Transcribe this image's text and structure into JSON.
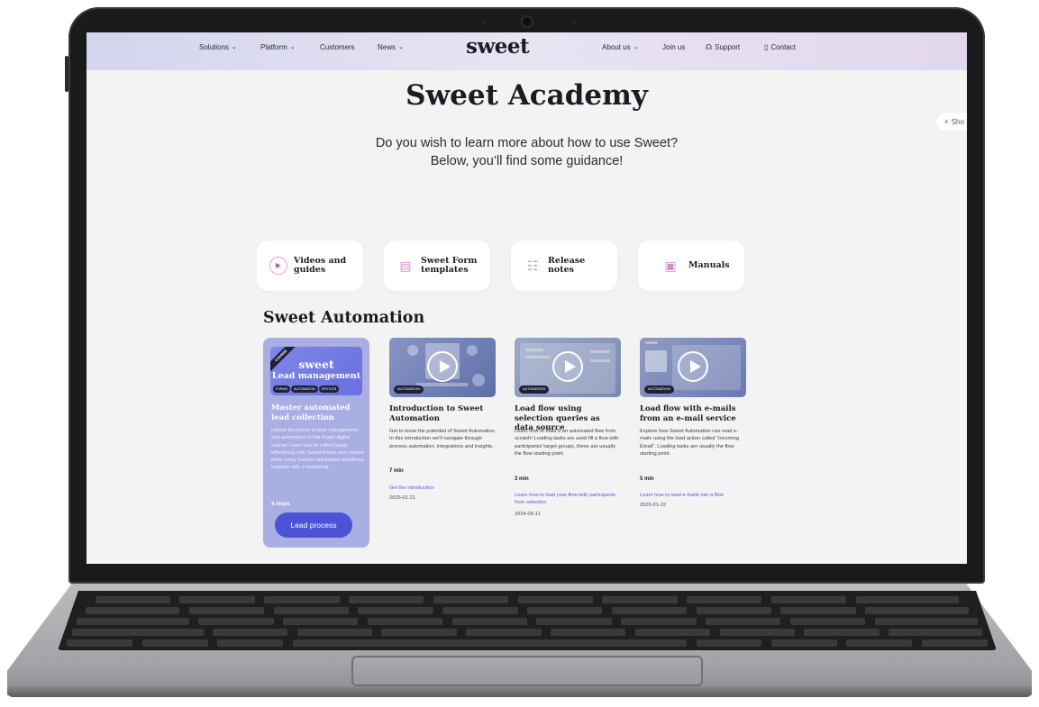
{
  "nav": {
    "left_items": [
      "Solutions",
      "Platform",
      "Customers",
      "News"
    ],
    "logo": "sweet",
    "right_items": [
      "About us",
      "Join us",
      "Support",
      "Contact"
    ]
  },
  "hero": {
    "title": "Sweet Academy",
    "subtitle_line1": "Do you wish to learn more about how to use Sweet?",
    "subtitle_line2": "Below, you’ll find some guidance!"
  },
  "show_chip": "Sho",
  "tiles": [
    {
      "label": "Videos and guides",
      "icon": "play-circle-icon"
    },
    {
      "label": "Sweet Form templates",
      "icon": "form-template-icon"
    },
    {
      "label": "Release notes",
      "icon": "release-notes-icon"
    },
    {
      "label": "Manuals",
      "icon": "laptop-manual-icon"
    }
  ],
  "section": {
    "title": "Sweet Automation"
  },
  "course": {
    "ribbon": "COURSE",
    "logo": "sweet",
    "logo_sub": "Lead management",
    "tags": [
      "FORMS",
      "AUTOMATION",
      "SPOTLER"
    ],
    "title": "Master automated lead collection",
    "description": "Unlock the power of lead management and automation in this 4-part digital course! Learn how to collect leads effortlessly with Sweet Forms and nurture them using Sweet’s automated workflows together with e-marketing.",
    "steps": "4 steps",
    "button": "Lead process"
  },
  "videos": [
    {
      "tag": "AUTOMATION",
      "title": "Introduction to Sweet Automation",
      "description": "Get to know the potential of Sweet Automation. In this introduction we’ll navigate through process automation, integrations and insights.",
      "time": "7 min",
      "link": "Get the introduction",
      "date": "2025-01-21"
    },
    {
      "tag": "AUTOMATION",
      "title": "Load flow using selection queries as data source",
      "description": "Learn how to build a an automated flow from scratch! Loading tasks are used fill a flow with participants/ target groups, these are usually the flow starting point.",
      "time": "3 min",
      "link": "Learn how to load your flow with participants from selection",
      "date": "2024-09-11"
    },
    {
      "tag": "AUTOMATION",
      "title": "Load flow with e-mails from an e-mail service",
      "description": "Explore how Sweet Automation can read e-mails using the load action called “Incoming Email”. Loading tasks are usually the flow starting point.",
      "time": "5 min",
      "link": "Learn how to read e-mails into a flow",
      "date": "2025-01-22"
    }
  ],
  "colors": {
    "accent": "#4c53d6",
    "link": "#5258d8",
    "course_card": "#a9aee3",
    "page_bg": "#f4f3f4"
  }
}
